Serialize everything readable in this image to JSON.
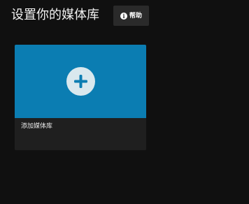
{
  "header": {
    "title": "设置你的媒体库",
    "help_label": "帮助",
    "help_icon": "info-icon"
  },
  "library_card": {
    "label": "添加媒体库",
    "icon": "plus-icon",
    "accent_color": "#0b7db2"
  }
}
